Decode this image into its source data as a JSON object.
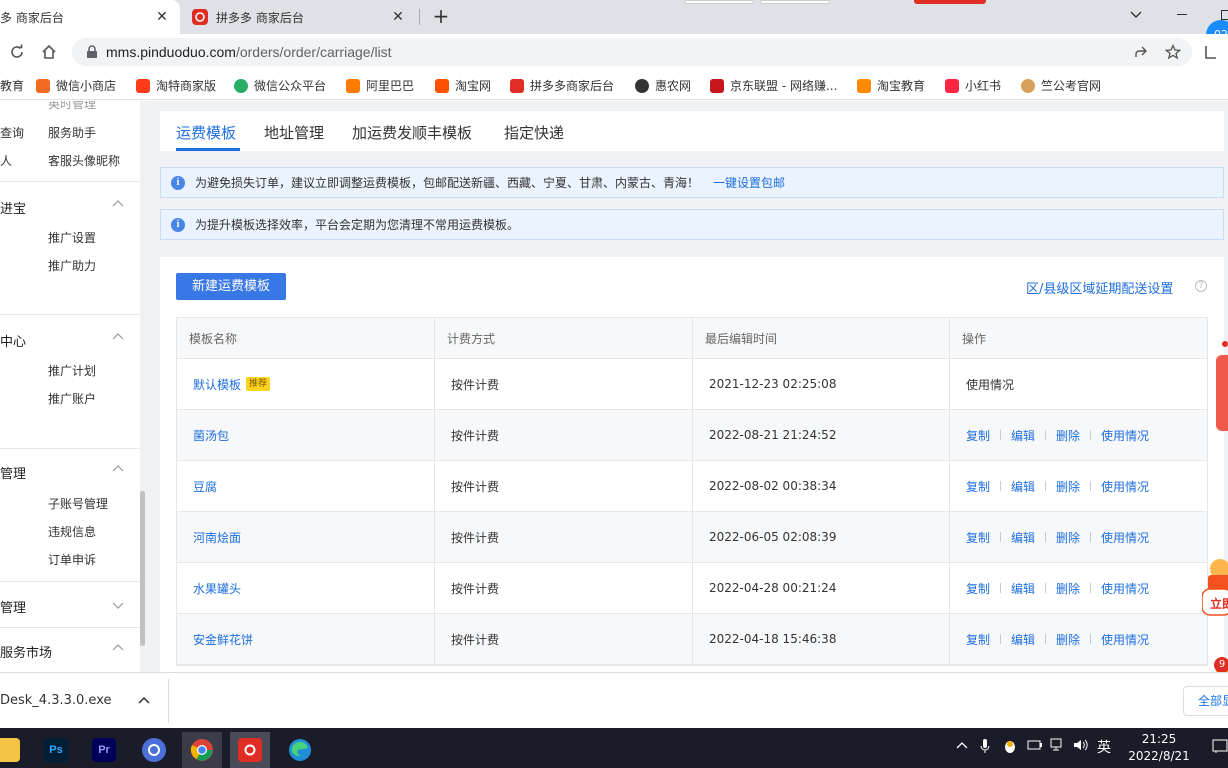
{
  "browser": {
    "tabs": [
      {
        "title": "多 商家后台",
        "active": true
      },
      {
        "title": "拼多多 商家后台",
        "active": false
      }
    ],
    "new_tab": "+",
    "profile_badge": "02",
    "url_host": "mms.pinduoduo.com",
    "url_path": "/orders/order/carriage/list"
  },
  "bookmarks": [
    {
      "label": "教育"
    },
    {
      "label": "微信小商店",
      "color": "#f36b20"
    },
    {
      "label": "淘特商家版",
      "color": "#ff3c1a"
    },
    {
      "label": "微信公众平台",
      "color": "#2aae67"
    },
    {
      "label": "阿里巴巴",
      "color": "#ff7a00"
    },
    {
      "label": "淘宝网",
      "color": "#ff5000"
    },
    {
      "label": "拼多多商家后台",
      "color": "#e02e24"
    },
    {
      "label": "惠农网",
      "color": "#333333"
    },
    {
      "label": "京东联盟 - 网络赚...",
      "color": "#c8161d"
    },
    {
      "label": "淘宝教育",
      "color": "#ff8a00"
    },
    {
      "label": "小红书",
      "color": "#ff2442"
    },
    {
      "label": "竺公考官网",
      "color": "#d9a05b"
    }
  ],
  "sidebar": {
    "top_partial": "英时管理",
    "rows": [
      {
        "left": "查询",
        "right": "服务助手"
      },
      {
        "left": "人",
        "right": "客服头像昵称"
      }
    ],
    "groups": [
      {
        "title": "进宝",
        "chevron": "up",
        "items": [
          "推广设置",
          "推广助力"
        ]
      },
      {
        "title": "中心",
        "chevron": "up",
        "items": [
          "推广计划",
          "推广账户"
        ]
      },
      {
        "title": "管理",
        "chevron": "up",
        "items": [
          "子账号管理",
          "违规信息",
          "订单申诉"
        ]
      },
      {
        "title": "管理",
        "chevron": "down",
        "items": []
      },
      {
        "title": "服务市场",
        "chevron": "up",
        "items": []
      }
    ]
  },
  "page_tabs": [
    "运费模板",
    "地址管理",
    "加运费发顺丰模板",
    "指定快递"
  ],
  "notices": [
    {
      "text": "为避免损失订单，建议立即调整运费模板，包邮配送新疆、西藏、宁夏、甘肃、内蒙古、青海！",
      "link": "一键设置包邮"
    },
    {
      "text": "为提升模板选择效率，平台会定期为您清理不常用运费模板。",
      "link": ""
    }
  ],
  "main": {
    "new_button": "新建运费模板",
    "region_link": "区/县级区域延期配送设置",
    "help": "?",
    "columns": [
      "模板名称",
      "计费方式",
      "最后编辑时间",
      "操作"
    ],
    "recommend_tag": "推荐",
    "actions": [
      "复制",
      "编辑",
      "删除",
      "使用情况"
    ],
    "rows": [
      {
        "name": "默认模板",
        "billing": "按件计费",
        "time": "2021-12-23 02:25:08",
        "recommended": true
      },
      {
        "name": "菌汤包",
        "billing": "按件计费",
        "time": "2022-08-21 21:24:52"
      },
      {
        "name": "豆腐",
        "billing": "按件计费",
        "time": "2022-08-02 00:38:34"
      },
      {
        "name": "河南烩面",
        "billing": "按件计费",
        "time": "2022-06-05 02:08:39"
      },
      {
        "name": "水果罐头",
        "billing": "按件计费",
        "time": "2022-04-28 00:21:24"
      },
      {
        "name": "安金鲜花饼",
        "billing": "按件计费",
        "time": "2022-04-18 15:46:38"
      }
    ]
  },
  "floating": {
    "gift_label": "立即",
    "badge": "9"
  },
  "download": {
    "filename": "Desk_4.3.3.0.exe",
    "show_all": "全部显示"
  },
  "taskbar": {
    "apps": [
      "文件资源管理器",
      "Ps",
      "Pr",
      "未知应用",
      "Chrome",
      "拼多多",
      "Edge"
    ],
    "ime": "英",
    "time": "21:25",
    "date": "2022/8/21"
  }
}
